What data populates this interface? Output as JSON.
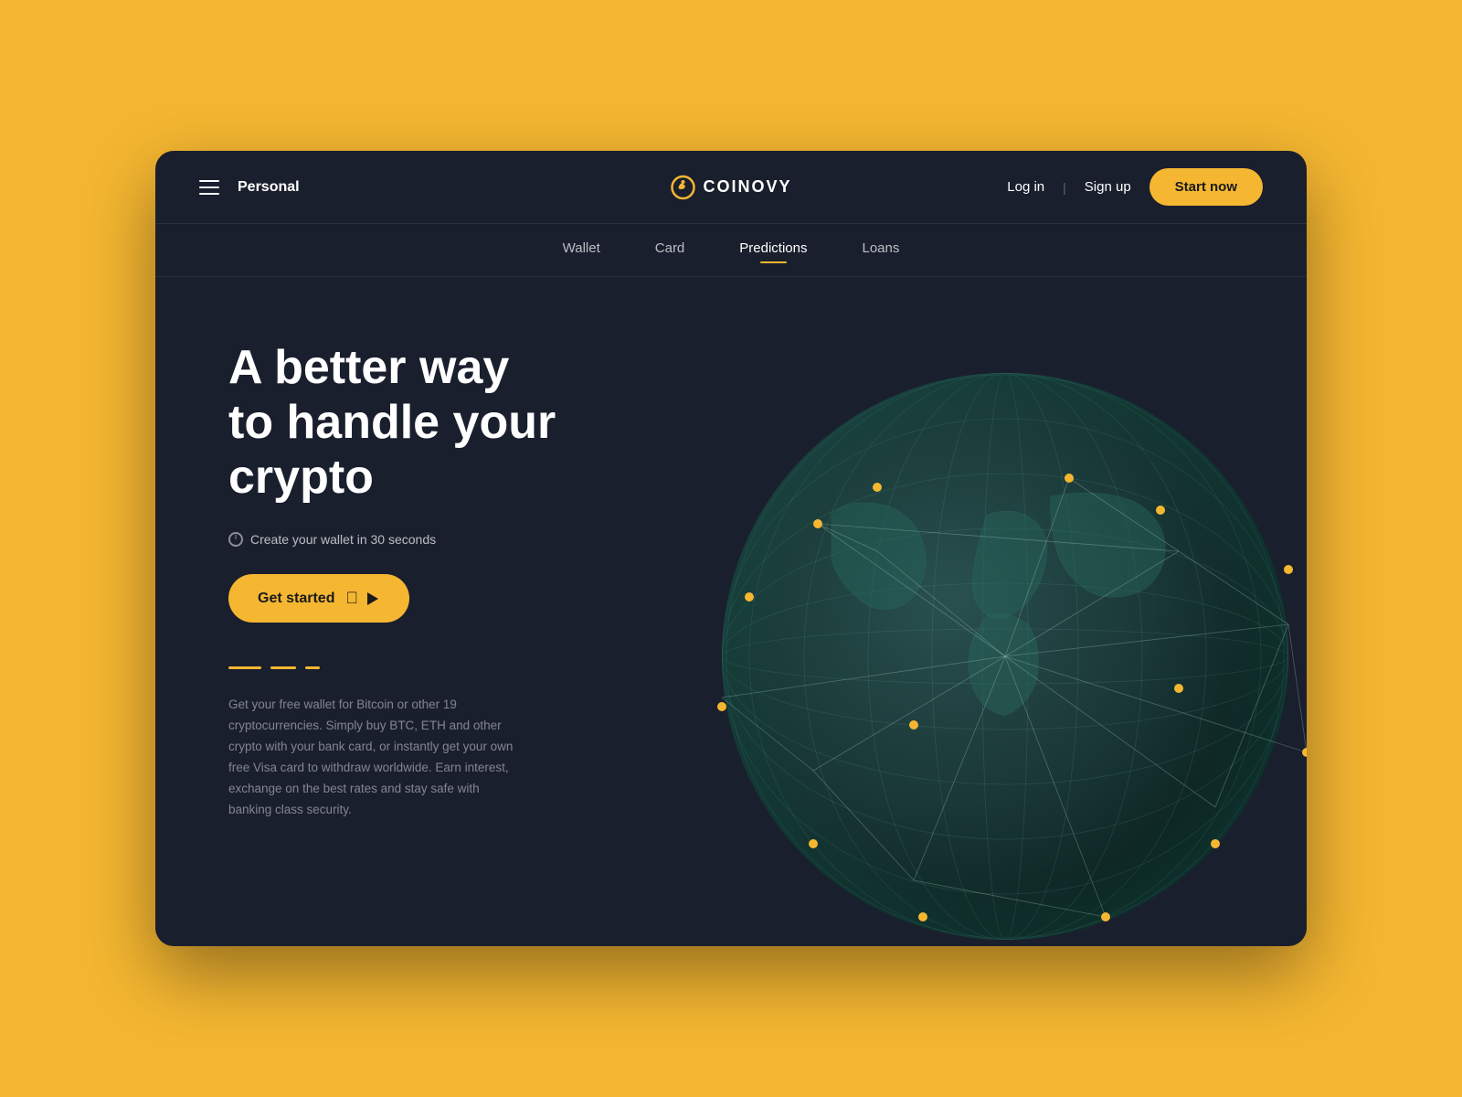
{
  "page": {
    "background_color": "#F5B731",
    "window_bg": "#1a1f2e"
  },
  "header": {
    "hamburger_label": "menu",
    "personal_label": "Personal",
    "logo_text": "COINOVY",
    "login_label": "Log in",
    "signup_label": "Sign up",
    "start_now_label": "Start now"
  },
  "sub_nav": {
    "items": [
      {
        "label": "Wallet",
        "active": false
      },
      {
        "label": "Card",
        "active": false
      },
      {
        "label": "Predictions",
        "active": true
      },
      {
        "label": "Loans",
        "active": false
      }
    ]
  },
  "hero": {
    "title_line1": "A better way",
    "title_line2": "to handle your crypto",
    "subtitle": "Create your wallet in 30 seconds",
    "cta_label": "Get started",
    "description": "Get your free wallet for Bitcoin or other 19 cryptocurrencies. Simply buy BTC, ETH and other crypto with your bank card, or instantly get your own free Visa card to withdraw worldwide. Earn interest, exchange on the best rates and stay safe with banking class security."
  },
  "globe": {
    "dot_color": "#F5B731",
    "line_color": "rgba(180,220,210,0.35)",
    "sphere_color_start": "#1e3a3a",
    "sphere_color_end": "#0d2020"
  }
}
